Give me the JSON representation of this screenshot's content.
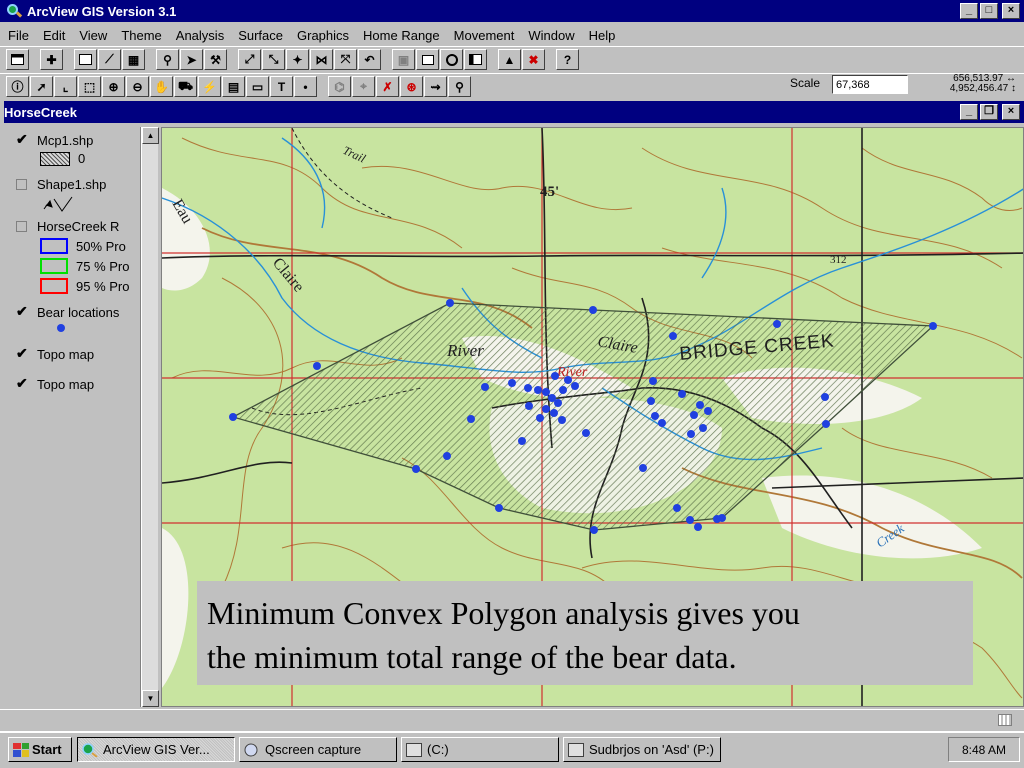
{
  "app": {
    "title": "ArcView GIS Version 3.1",
    "close_glyph": "×",
    "minimize_glyph": "_",
    "maximize_glyph": "□",
    "restore_glyph": "❐"
  },
  "menu": [
    "File",
    "Edit",
    "View",
    "Theme",
    "Analysis",
    "Surface",
    "Graphics",
    "Home Range",
    "Movement",
    "Window",
    "Help"
  ],
  "toolbar": {
    "scale_label": "Scale",
    "scale_value": "67,368",
    "coord_x": "656,513.97",
    "coord_y": "4,952,456.47",
    "coord_x_arrow": "↔",
    "coord_y_arrow": "↕"
  },
  "view": {
    "title": "HorseCreek"
  },
  "toc": {
    "layers": [
      {
        "label": "Mcp1.shp",
        "checked": true,
        "legend": "0"
      },
      {
        "label": "Shape1.shp",
        "checked": false
      },
      {
        "label": "HorseCreek R",
        "checked": false,
        "classes": [
          {
            "label": "50% Pro",
            "color": "#0000ff"
          },
          {
            "label": "75 % Pro",
            "color": "#00e000"
          },
          {
            "label": "95 % Pro",
            "color": "#ff0000"
          }
        ]
      },
      {
        "label": "Bear locations",
        "checked": true
      },
      {
        "label": "Topo map",
        "checked": true
      },
      {
        "label": "Topo map",
        "checked": true
      }
    ]
  },
  "map": {
    "labels": {
      "eau": "Eau",
      "claire": "Claire",
      "river": "River",
      "bridge_creek": "BRIDGE CREEK",
      "trail": "Trail",
      "elev_45": "45'",
      "elev_312": "312",
      "creek": "Creek",
      "claire2": "Claire",
      "river2": "River"
    },
    "point_color": "#2040e0",
    "polygon_fill": "#8fa878"
  },
  "caption": {
    "line1": "Minimum Convex Polygon analysis gives you",
    "line2": "the minimum total range of the bear data."
  },
  "taskbar": {
    "start": "Start",
    "tasks": [
      "ArcView GIS Ver...",
      "Qscreen capture",
      "(C:)",
      "Sudbrjos on 'Asd' (P:)"
    ],
    "clock": "8:48 AM"
  }
}
